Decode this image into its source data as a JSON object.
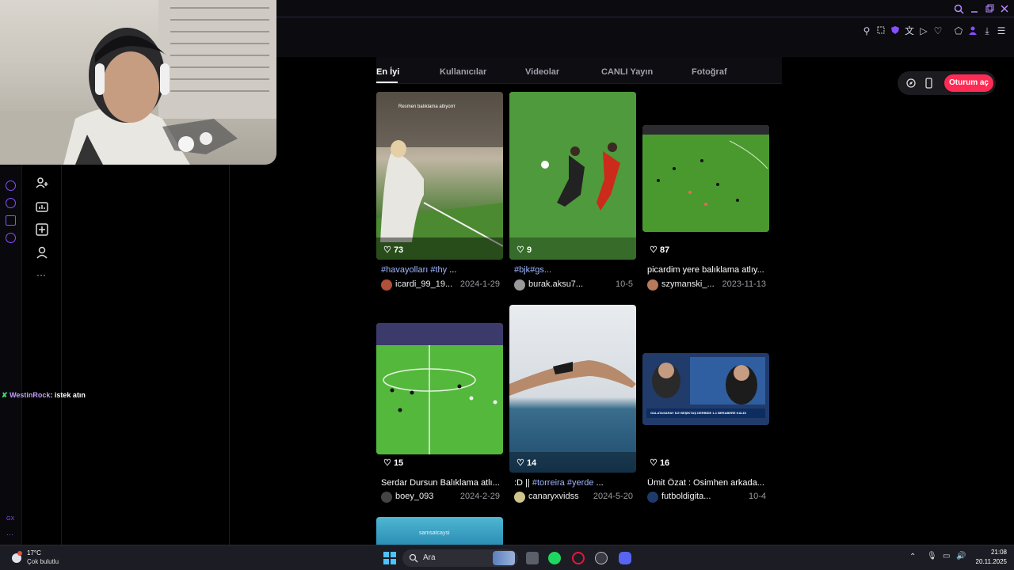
{
  "tabs": [
    "En İyi",
    "Kullanıcılar",
    "Videolar",
    "CANLI Yayın",
    "Fotoğraf"
  ],
  "login_label": "Oturum aç",
  "chat": {
    "user": "WestinRock",
    "message": ": istek atın"
  },
  "sidebar_label": "GX",
  "cards": [
    {
      "overlay": "Resmen balıklama atlıyorrr",
      "likes": "73",
      "caption_tag": "#havayolları #thy",
      "caption_rest": " ...",
      "user": "icardi_99_19...",
      "date": "2024-1-29"
    },
    {
      "overlay": "",
      "likes": "9",
      "caption_tag": "#bjk#gs...",
      "caption_rest": "",
      "user": "burak.aksu7...",
      "date": "10-5"
    },
    {
      "overlay": "",
      "likes": "87",
      "caption_tag": "",
      "caption_rest": "picardim yere balıklama atlıy...",
      "user": "szymanski_...",
      "date": "2023-11-13"
    },
    {
      "overlay": "",
      "likes": "15",
      "caption_tag": "",
      "caption_rest": "Serdar Dursun Balıklama atlı...",
      "user": "boey_093",
      "date": "2024-2-29"
    },
    {
      "overlay": "",
      "likes": "14",
      "caption_tag": "#torreira #yerde",
      "caption_pre": ":D || ",
      "caption_rest": " ...",
      "user": "canaryxvidss",
      "date": "2024-5-20"
    },
    {
      "overlay": "GALATASARAY İLE BEŞİKTAŞ DERBİDE 1-1 BERABERE KALDI",
      "likes": "16",
      "caption_tag": "",
      "caption_rest": "Ümit Özat : Osimhen arkada...",
      "user": "futboldigita...",
      "date": "10-4"
    }
  ],
  "extra_thumb_text": "samsatcaysi",
  "taskbar": {
    "weather_temp": "17°C",
    "weather_desc": "Çok bulutlu",
    "search_placeholder": "Ara",
    "time": "21:08",
    "date": "20.11.2025"
  },
  "colors": {
    "accent": "#fe2c55",
    "link": "#9db7ff",
    "opera": "#8a4dff"
  }
}
